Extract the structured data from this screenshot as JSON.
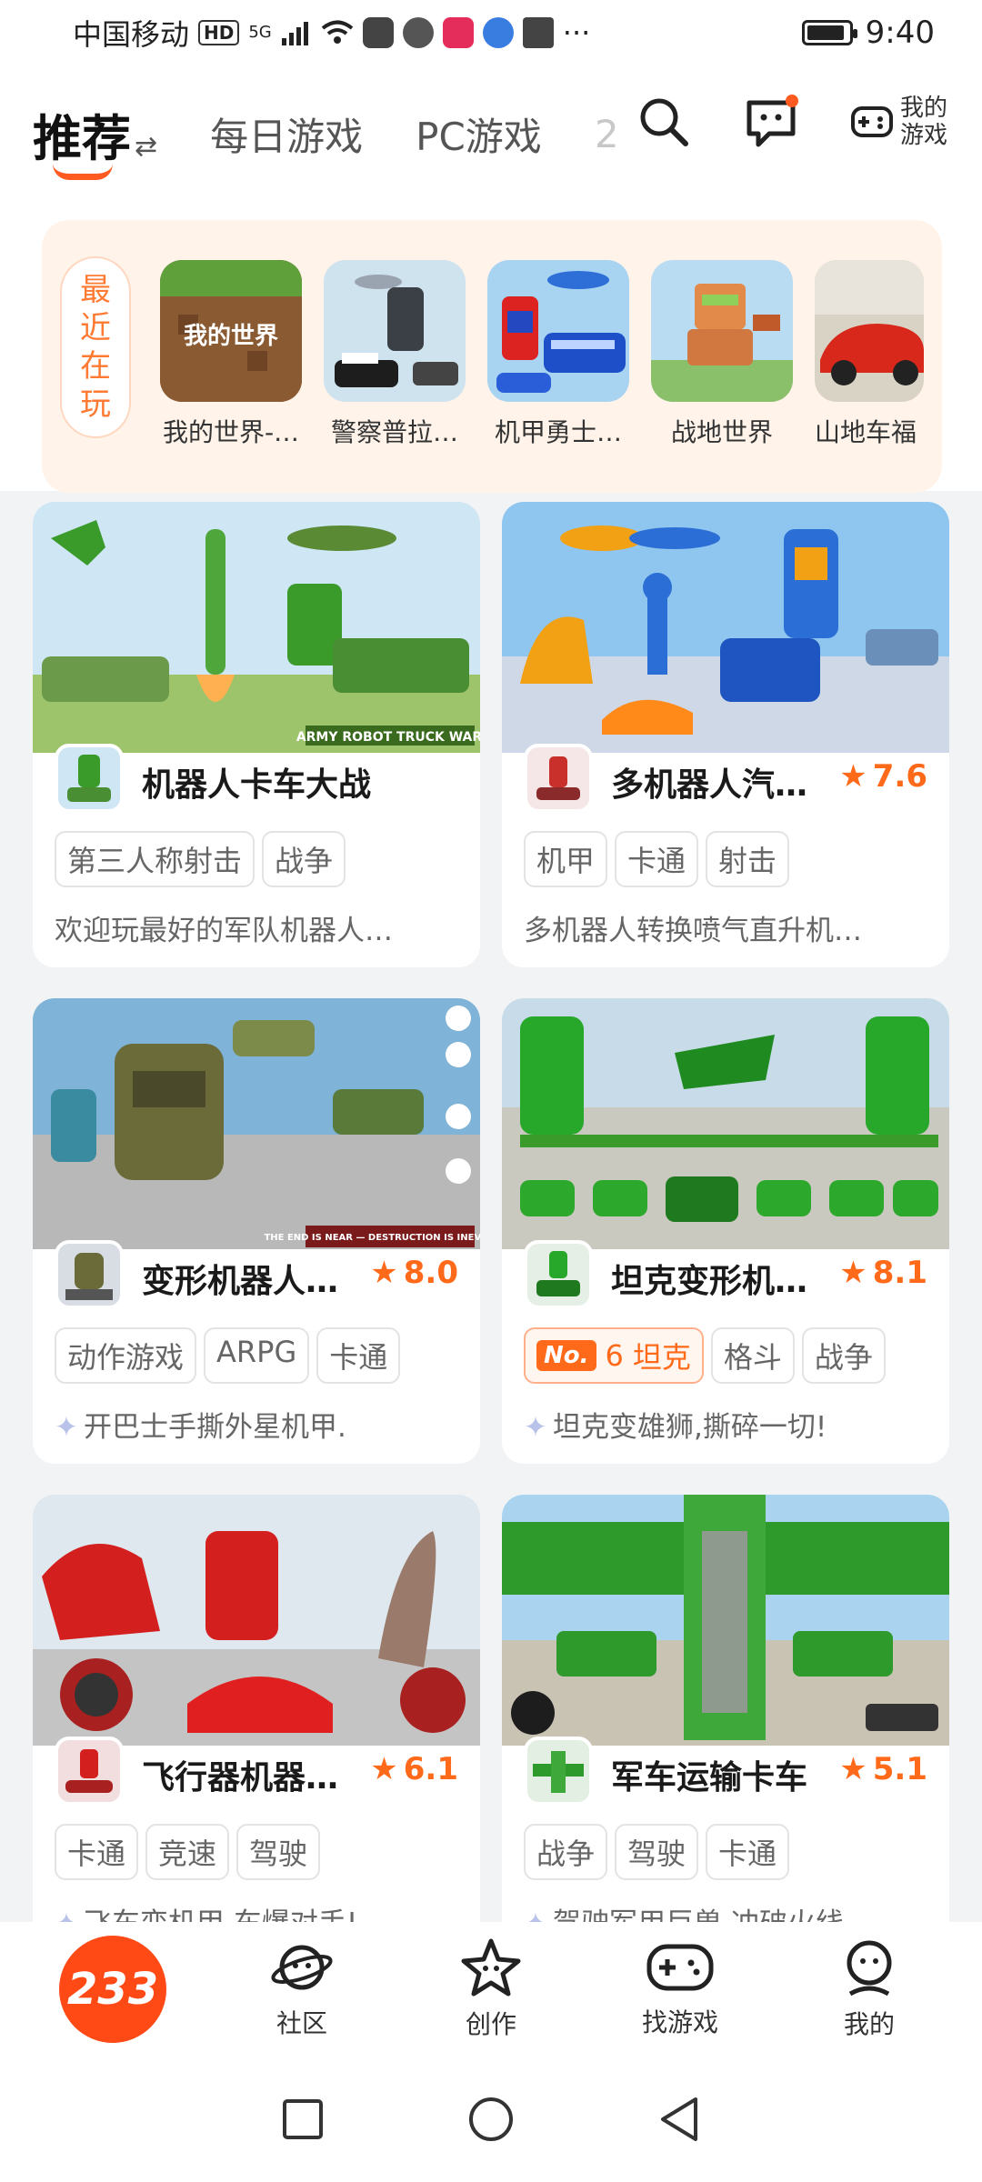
{
  "status_bar": {
    "carrier": "中国移动",
    "hd": "HD",
    "network": "5G",
    "more": "···",
    "time": "9:40",
    "battery_level": 0.9
  },
  "header": {
    "tabs": [
      {
        "label": "推荐",
        "active": true
      },
      {
        "label": "每日游戏"
      },
      {
        "label": "PC游戏"
      },
      {
        "label": "2"
      }
    ],
    "swap_symbol": "⇄",
    "my_games_label": "我的游戏",
    "icons": [
      "search-icon",
      "message-icon",
      "my-games-icon"
    ]
  },
  "recent": {
    "tag_label": "最近在玩",
    "items": [
      {
        "name": "我的世界-…",
        "thumb_text": "我的世界"
      },
      {
        "name": "警察普拉…",
        "thumb_text": ""
      },
      {
        "name": "机甲勇士…",
        "thumb_text": ""
      },
      {
        "name": "战地世界",
        "thumb_text": ""
      },
      {
        "name": "山地车福",
        "thumb_text": ""
      }
    ]
  },
  "games": [
    {
      "title": "机器人卡车大战",
      "rating": "",
      "tags": [
        "第三人称射击",
        "战争"
      ],
      "desc": "欢迎玩最好的军队机器人…",
      "desc_sparkle": false,
      "banner_text": "ARMY ROBOT TRUCK WAR",
      "colors": {
        "sky": "#cfe6f5",
        "ground": "#9dc46a",
        "main": "#3a9a2a"
      }
    },
    {
      "title": "多机器人汽…",
      "rating": "7.6",
      "tags": [
        "机甲",
        "卡通",
        "射击"
      ],
      "desc": "多机器人转换喷气直升机…",
      "desc_sparkle": false,
      "banner_text": "",
      "colors": {
        "sky": "#8ec6f0",
        "ground": "#cfd8e6",
        "main": "#2b6fd6"
      }
    },
    {
      "title": "变形机器人…",
      "rating": "8.0",
      "tags": [
        "动作游戏",
        "ARPG",
        "卡通"
      ],
      "desc": "开巴士手撕外星机甲.",
      "desc_sparkle": true,
      "banner_text": "THE END IS NEAR — DESTRUCTION IS INEVITABLE",
      "colors": {
        "sky": "#7fb3d8",
        "ground": "#b8b8b8",
        "main": "#6b6b3a"
      }
    },
    {
      "title": "坦克变形机…",
      "rating": "8.1",
      "rank": {
        "badge": "No.",
        "number": "6",
        "label": "坦克"
      },
      "tags": [
        "格斗",
        "战争"
      ],
      "desc": "坦克变雄狮,撕碎一切!",
      "desc_sparkle": true,
      "banner_text": "",
      "colors": {
        "sky": "#c7dce8",
        "ground": "#c9c9c0",
        "main": "#28a82a"
      }
    },
    {
      "title": "飞行器机器…",
      "rating": "6.1",
      "tags": [
        "卡通",
        "竞速",
        "驾驶"
      ],
      "desc": "飞车变机甲,车爆对手!",
      "desc_sparkle": true,
      "banner_text": "",
      "colors": {
        "sky": "#dfe8ef",
        "ground": "#c4c4c4",
        "main": "#d41f1f"
      }
    },
    {
      "title": "军车运输卡车",
      "rating": "5.1",
      "tags": [
        "战争",
        "驾驶",
        "卡通"
      ],
      "desc": "驾驶军用巨兽,冲破火线",
      "desc_sparkle": true,
      "banner_text": "",
      "colors": {
        "sky": "#a9d3ee",
        "ground": "#c9c3b4",
        "main": "#2f9a2c"
      }
    }
  ],
  "bottom_nav": {
    "home_label": "233",
    "items": [
      {
        "label": "社区",
        "icon": "planet-face-icon"
      },
      {
        "label": "创作",
        "icon": "star-face-icon"
      },
      {
        "label": "找游戏",
        "icon": "gamepad-icon"
      },
      {
        "label": "我的",
        "icon": "person-face-icon"
      }
    ]
  },
  "theme": {
    "accent": "#ff5a1f",
    "rating": "#ff6a1a"
  }
}
